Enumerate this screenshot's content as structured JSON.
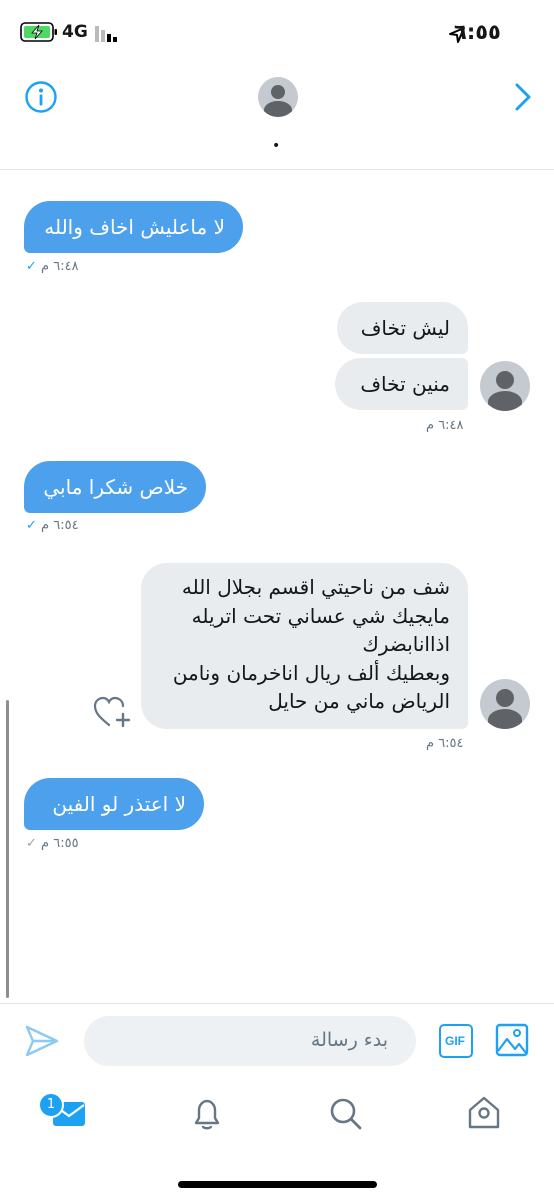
{
  "status_bar": {
    "time": "٦:٥٥",
    "network": "4G"
  },
  "header": {
    "dot": "•"
  },
  "messages": [
    {
      "text": "لا ماعليش اخاف والله",
      "time": "٦:٤٨ م",
      "check": "✓"
    },
    {
      "text": "ليش تخاف"
    },
    {
      "text": "منين تخاف",
      "time": "٦:٤٨ م"
    },
    {
      "text": "خلاص شكرا مابي",
      "time": "٦:٥٤ م",
      "check": "✓"
    },
    {
      "line1": "شف من ناحيتي اقسم بجلال الله",
      "line2": "مايجيك شي عساني تحت اتريله",
      "line3": "اذاانابضرك",
      "line4": "وبعطيك ألف ريال اناخرمان ونامن",
      "line5": "الرياض ماني من حايل",
      "time": "٦:٥٤ م"
    },
    {
      "text": "لا اعتذر لو  الفين",
      "time": "٦:٥٥ م",
      "check": "✓"
    }
  ],
  "composer": {
    "placeholder": "بدء رسالة",
    "gif_label": "GIF"
  },
  "tab_bar": {
    "badge": "1"
  },
  "icons": [
    "info-icon",
    "chevron-right-icon",
    "send-icon",
    "gif-icon",
    "image-icon",
    "heart-plus-icon",
    "messages-icon",
    "bell-icon",
    "search-icon",
    "home-icon",
    "location-arrow-icon",
    "battery-icon",
    "signal-icon"
  ],
  "colors": {
    "accent": "#1da1f2",
    "bubble_blue": "#4da0eb",
    "bubble_gray": "#e8ecef",
    "meta": "#657786"
  }
}
